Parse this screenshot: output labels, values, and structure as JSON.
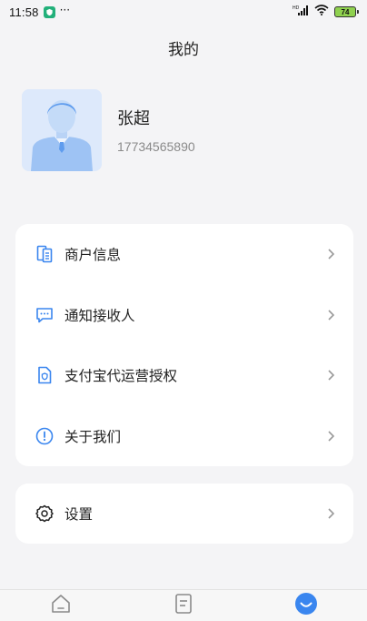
{
  "status_bar": {
    "time": "11:58",
    "notification_dots": "···",
    "battery_level": "74",
    "network_label": "HD"
  },
  "header": {
    "title": "我的"
  },
  "profile": {
    "name": "张超",
    "phone": "17734565890"
  },
  "menu": {
    "items": [
      {
        "label": "商户信息",
        "icon": "merchant-info-icon"
      },
      {
        "label": "通知接收人",
        "icon": "message-icon"
      },
      {
        "label": "支付宝代运营授权",
        "icon": "authorization-icon"
      },
      {
        "label": "关于我们",
        "icon": "info-icon"
      }
    ],
    "settings": {
      "label": "设置",
      "icon": "gear-icon"
    }
  },
  "bottom_nav": {
    "tabs": [
      {
        "icon": "home-icon",
        "active": false
      },
      {
        "icon": "document-icon",
        "active": false
      },
      {
        "icon": "profile-icon",
        "active": true
      }
    ]
  },
  "colors": {
    "accent": "#3a86ef",
    "background": "#f4f4f6",
    "card": "#ffffff",
    "secondary_text": "#8a8a8a",
    "chevron": "#9a9a9a"
  }
}
